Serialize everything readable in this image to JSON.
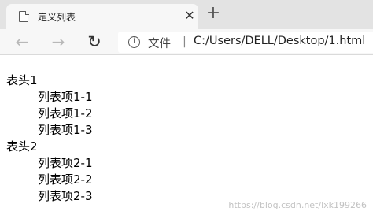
{
  "browser": {
    "tab": {
      "title": "定义列表",
      "close_glyph": "✕"
    },
    "new_tab_glyph": "+",
    "nav": {
      "back_glyph": "←",
      "forward_glyph": "→",
      "reload_glyph": "↻"
    },
    "address": {
      "info_glyph": "i",
      "scheme_label": "文件",
      "separator": "|",
      "url": "C:/Users/DELL/Desktop/1.html"
    }
  },
  "page": {
    "definition_list": [
      {
        "term": "表头1",
        "items": [
          "列表项1-1",
          "列表项1-2",
          "列表项1-3"
        ]
      },
      {
        "term": "表头2",
        "items": [
          "列表项2-1",
          "列表项2-2",
          "列表项2-3"
        ]
      }
    ],
    "watermark": "https://blog.csdn.net/lxk199266"
  }
}
